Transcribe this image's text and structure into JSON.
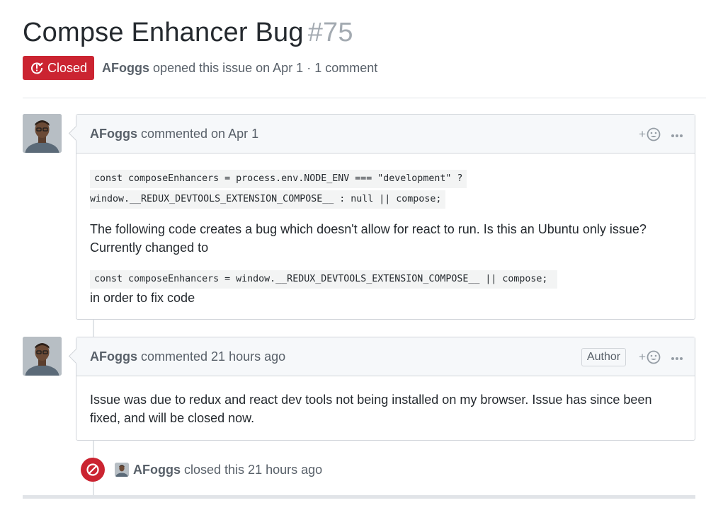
{
  "issue": {
    "title": "Compse Enhancer Bug",
    "number": "#75",
    "state": "Closed",
    "author": "AFoggs",
    "meta": "opened this issue on Apr 1 · 1 comment"
  },
  "comments": [
    {
      "author": "AFoggs",
      "action": "commented on Apr 1",
      "code1_line1": "const composeEnhancers = process.env.NODE_ENV === \"development\" ?",
      "code1_line2": "window.__REDUX_DEVTOOLS_EXTENSION_COMPOSE__ : null || compose;",
      "paragraph": "The following code creates a bug which doesn't allow for react to run. Is this an Ubuntu only issue? Currently changed to",
      "code2": "const composeEnhancers = window.__REDUX_DEVTOOLS_EXTENSION_COMPOSE__ || compose; ",
      "after_code": "in order to fix code"
    },
    {
      "author": "AFoggs",
      "action": "commented 21 hours ago",
      "badge": "Author",
      "paragraph": "Issue was due to redux and react dev tools not being installed on my browser. Issue has since been fixed, and will be closed now."
    }
  ],
  "event": {
    "author": "AFoggs",
    "text": "closed this 21 hours ago"
  },
  "icons": {
    "state": "issue-closed-icon",
    "reaction": "smiley-icon",
    "menu": "kebab-horizontal-icon",
    "event": "circle-slash-icon"
  },
  "colors": {
    "closed_red": "#cb2431",
    "meta_gray": "#586069",
    "border": "#d1d5da",
    "header_bg": "#f6f8fa"
  }
}
